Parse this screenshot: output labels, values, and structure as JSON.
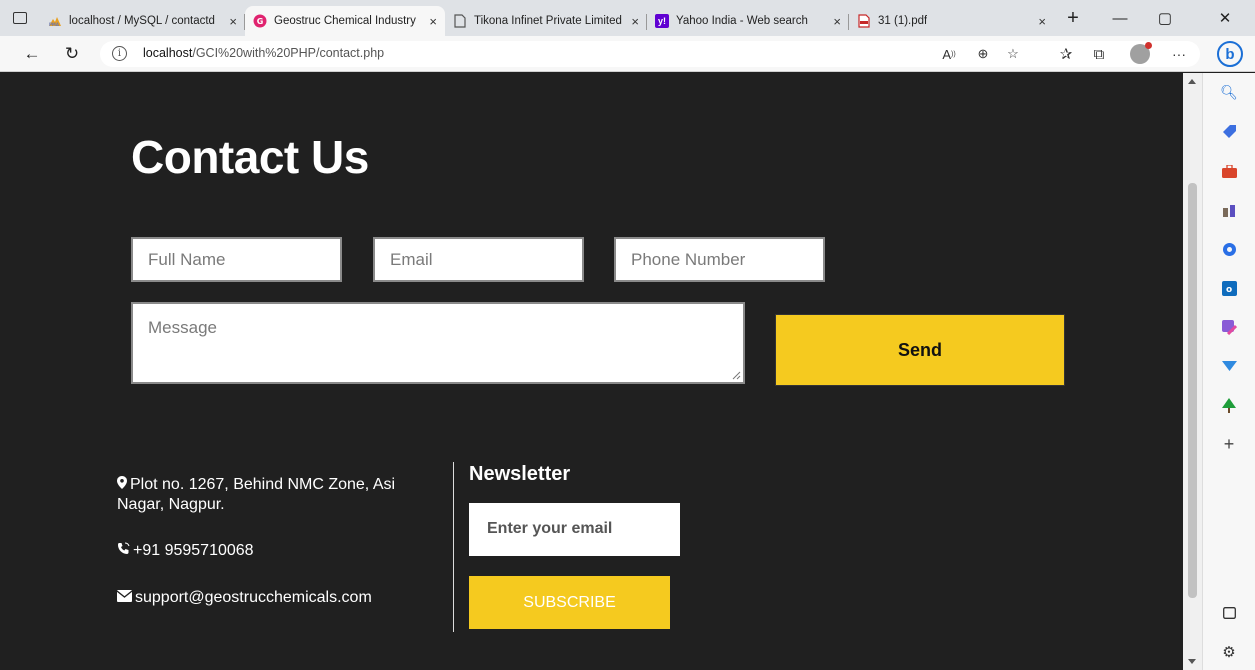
{
  "browser": {
    "tabs": [
      {
        "title": "localhost / MySQL / contactd",
        "favicon": "phpmyadmin-icon",
        "close": "×"
      },
      {
        "title": "Geostruc Chemical Industry",
        "favicon": "geostruc-icon",
        "close": "×",
        "active": true
      },
      {
        "title": "Tikona Infinet Private Limited",
        "favicon": "page-icon",
        "close": "×"
      },
      {
        "title": "Yahoo India - Web search",
        "favicon": "yahoo-icon",
        "close": "×"
      },
      {
        "title": "31 (1).pdf",
        "favicon": "pdf-icon",
        "close": "×"
      }
    ],
    "new_tab": "+",
    "url_host": "localhost",
    "url_path": "/GCI%20with%20PHP/contact.php",
    "more_menu": "···"
  },
  "page": {
    "heading": "Contact Us",
    "form": {
      "full_name_placeholder": "Full Name",
      "email_placeholder": "Email",
      "phone_placeholder": "Phone Number",
      "message_placeholder": "Message",
      "send_label": "Send"
    },
    "footer": {
      "address": "Plot no. 1267, Behind NMC Zone, Asi Nagar, Nagpur.",
      "phone": "+91 9595710068",
      "email": "support@geostrucchemicals.com",
      "newsletter_title": "Newsletter",
      "newsletter_placeholder": "Enter your email",
      "subscribe_label": "SUBSCRIBE"
    }
  },
  "colors": {
    "page_bg": "#202020",
    "accent_yellow": "#f5ca1f"
  }
}
